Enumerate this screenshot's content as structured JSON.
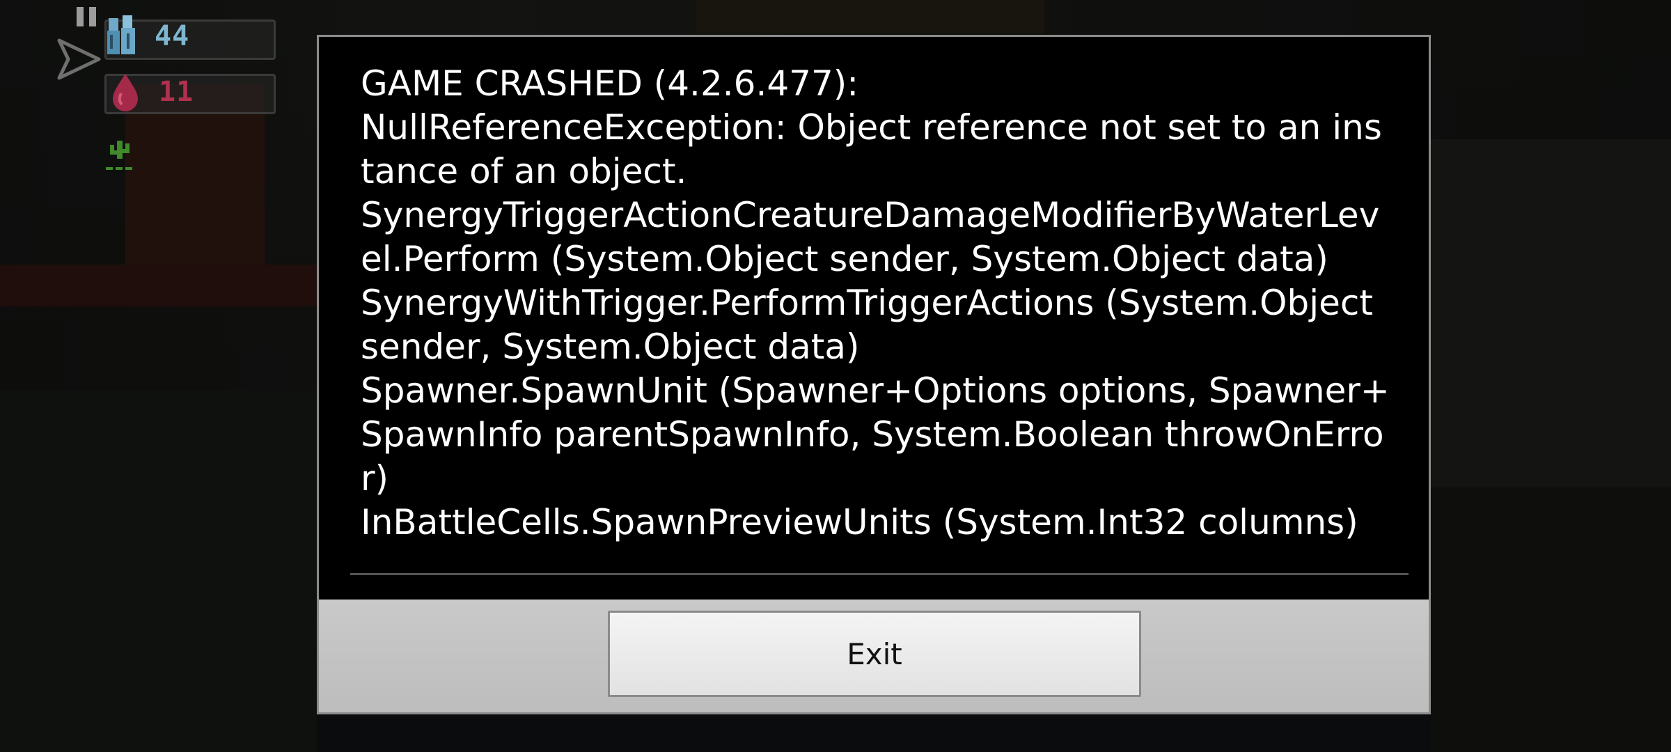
{
  "hud": {
    "soldiers_count": "44",
    "blood_count": "11",
    "soldiers_icon": "soldiers-icon",
    "blood_icon": "blood-drop-icon",
    "plant_icon": "cactus-icon",
    "pause_icon": "pause-icon",
    "arrow_icon": "paper-plane-icon",
    "colors": {
      "soldiers_num": "#7fb6cf",
      "blood_num": "#b03050",
      "plant": "#3f8a2a"
    }
  },
  "dialog": {
    "lines": [
      "GAME CRASHED (4.2.6.477):",
      "NullReferenceException: Object reference not set to an instance of an object.",
      "SynergyTriggerActionCreatureDamageModifierByWaterLevel.Perform (System.Object sender, System.Object data)",
      "SynergyWithTrigger.PerformTriggerActions (System.Object sender, System.Object data)",
      "Spawner.SpawnUnit (Spawner+Options options, Spawner+SpawnInfo parentSpawnInfo, System.Boolean throwOnError)",
      "InBattleCells.SpawnPreviewUnits (System.Int32 columns)"
    ],
    "exit_label": "Exit"
  }
}
